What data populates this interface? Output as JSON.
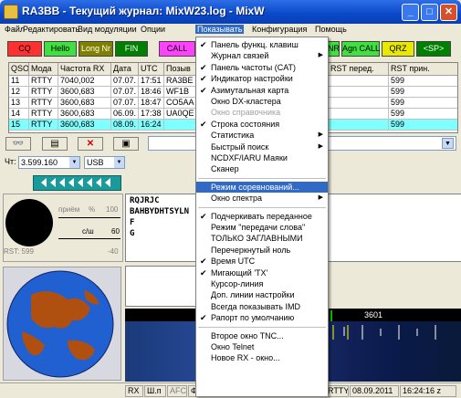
{
  "window": {
    "title": "RA3BB - Текущий журнал: MixW23.log - MixW"
  },
  "menu": [
    "Файл",
    "Редактировать",
    "Вид модуляции",
    "Опции",
    "Показывать",
    "Конфигурация",
    "Помощь"
  ],
  "macros": [
    {
      "label": "CQ",
      "bg": "#ff3030",
      "fg": "#000000"
    },
    {
      "label": "Hello",
      "bg": "#40e040",
      "fg": "#000000"
    },
    {
      "label": "Long Nr",
      "bg": "#808000",
      "fg": "#ffffff"
    },
    {
      "label": "FIN",
      "bg": "#008000",
      "fg": "#ffffff"
    },
    {
      "label": "CALL",
      "bg": "#ff40ff",
      "fg": "#000000"
    },
    {
      "label": "NR",
      "bg": "#40e040",
      "fg": "#000000"
    },
    {
      "label": "Agn CALL",
      "bg": "#40e040",
      "fg": "#000000"
    },
    {
      "label": "QRZ",
      "bg": "#e8e800",
      "fg": "#000000"
    },
    {
      "label": "<SP>",
      "bg": "#008000",
      "fg": "#ffffff"
    }
  ],
  "log_table": {
    "headers": [
      "QSO",
      "Мода",
      "Частота RX",
      "Дата",
      "UTC",
      "Позыв",
      "",
      "",
      "",
      "",
      "RST перед.",
      "RST прин."
    ],
    "rows": [
      {
        "qso": "11",
        "mode": "RTTY",
        "freq": "7040,002",
        "date": "07.07.",
        "utc": "17:51",
        "call": "RA3BE",
        "rst_sent": "",
        "rst_rcvd": "599"
      },
      {
        "qso": "12",
        "mode": "RTTY",
        "freq": "3600,683",
        "date": "07.07.",
        "utc": "18:46",
        "call": "WF1B",
        "rst_sent": "",
        "rst_rcvd": "599"
      },
      {
        "qso": "13",
        "mode": "RTTY",
        "freq": "3600,683",
        "date": "07.07.",
        "utc": "18:47",
        "call": "CO5AA",
        "rst_sent": "",
        "rst_rcvd": "599"
      },
      {
        "qso": "14",
        "mode": "RTTY",
        "freq": "3600,683",
        "date": "06.09.",
        "utc": "17:38",
        "call": "UA0QE",
        "rst_sent": "",
        "rst_rcvd": "599"
      },
      {
        "qso": "15",
        "mode": "RTTY",
        "freq": "3600,683",
        "date": "08.09.",
        "utc": "16:24",
        "call": "",
        "rst_sent": "",
        "rst_rcvd": "599"
      }
    ]
  },
  "freq_panel": {
    "label": "Чт:",
    "frequency": "3.599.160",
    "mode": "USB"
  },
  "receive_text": [
    "RQJRJC",
    "BAHBYDHTSYLN",
    "F",
    "G"
  ],
  "left_panel": {
    "priem": "приём",
    "pct": "%",
    "pct_val": "100",
    "cs": "c/ш",
    "cs_val": "60",
    "rst": "RST: 599",
    "minus40": "-40"
  },
  "waterfall": {
    "mark": "3601"
  },
  "status": {
    "rx": "RX",
    "sh": "Ш.п",
    "afc": "AFC",
    "f": "Ф",
    "mode": "RTTY",
    "date": "08.09.2011",
    "time": "16:24:16 z"
  },
  "dropdown": [
    {
      "label": "Панель функц. клавиш",
      "checked": true
    },
    {
      "label": "Журнал связей",
      "submenu": true
    },
    {
      "label": "Панель частоты (CAT)",
      "checked": true
    },
    {
      "label": "Индикатор настройки",
      "checked": true
    },
    {
      "label": "Азимутальная карта",
      "checked": true
    },
    {
      "label": "Окно DX-кластера"
    },
    {
      "label": "Окно справочника",
      "disabled": true
    },
    {
      "label": "Строка состояния",
      "checked": true
    },
    {
      "label": "Статистика",
      "submenu": true
    },
    {
      "label": "Быстрый поиск",
      "submenu": true
    },
    {
      "label": "NCDXF/IARU Маяки"
    },
    {
      "label": "Сканер"
    },
    {
      "sep": true
    },
    {
      "label": "Режим соревнований...",
      "selected": true
    },
    {
      "label": "Окно спектра",
      "submenu": true
    },
    {
      "sep": true
    },
    {
      "label": "Подчеркивать переданное",
      "checked": true
    },
    {
      "label": "Режим \"передачи слова\""
    },
    {
      "label": "ТОЛЬКО ЗАГЛАВНЫМИ"
    },
    {
      "label": "Перечеркнутый ноль"
    },
    {
      "label": "Время UTC",
      "checked": true
    },
    {
      "label": "Мигающий 'TX'",
      "checked": true
    },
    {
      "label": "Курсор-линия"
    },
    {
      "label": "Доп. линии настройки"
    },
    {
      "label": "Всегда показывать IMD"
    },
    {
      "label": "Рапорт по умолчанию",
      "checked": true
    },
    {
      "sep": true
    },
    {
      "label": "Второе окно TNC..."
    },
    {
      "label": "Окно Telnet"
    },
    {
      "label": "Новое RX - окно..."
    }
  ]
}
